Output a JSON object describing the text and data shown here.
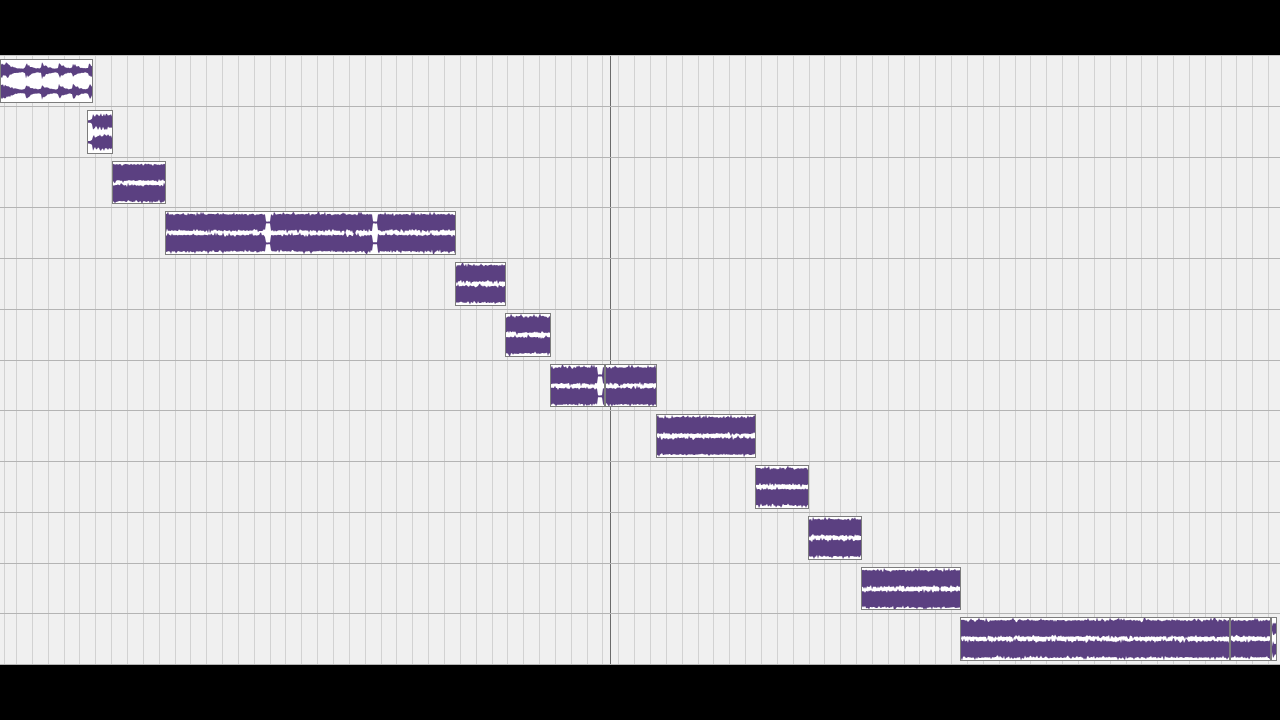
{
  "timeline": {
    "playhead": true
  },
  "tracks": [
    {
      "clips": [
        {
          "kind": "transient"
        }
      ]
    },
    {
      "clips": [
        {
          "kind": "transient"
        }
      ]
    },
    {
      "clips": [
        {
          "kind": "sustained"
        }
      ]
    },
    {
      "clips": [
        {
          "kind": "sustained"
        }
      ]
    },
    {
      "clips": [
        {
          "kind": "sustained"
        }
      ]
    },
    {
      "clips": [
        {
          "kind": "sustained"
        }
      ]
    },
    {
      "clips": [
        {
          "kind": "sustained"
        },
        {
          "kind": "sustained"
        }
      ]
    },
    {
      "clips": [
        {
          "kind": "sustained"
        }
      ]
    },
    {
      "clips": [
        {
          "kind": "sustained"
        }
      ]
    },
    {
      "clips": [
        {
          "kind": "sustained"
        }
      ]
    },
    {
      "clips": [
        {
          "kind": "sustained"
        }
      ]
    },
    {
      "clips": [
        {
          "kind": "sustained"
        },
        {
          "kind": "sustained"
        },
        {
          "kind": "transient"
        }
      ]
    }
  ]
}
